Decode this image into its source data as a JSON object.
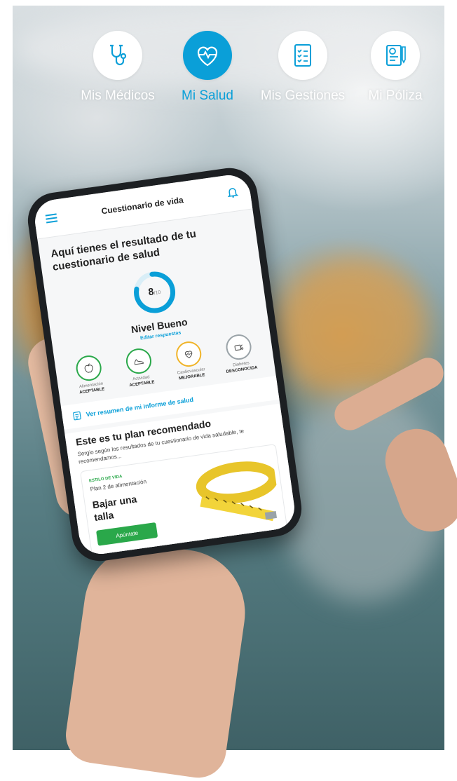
{
  "nav": {
    "items": [
      {
        "label": "Mis Médicos",
        "icon": "stethoscope-icon",
        "active": false
      },
      {
        "label": "Mi Salud",
        "icon": "heart-pulse-icon",
        "active": true
      },
      {
        "label": "Mis Gestiones",
        "icon": "checklist-icon",
        "active": false
      },
      {
        "label": "Mi Póliza",
        "icon": "policy-document-icon",
        "active": false
      }
    ]
  },
  "colors": {
    "accent": "#0a9fd8",
    "green": "#2aa84a",
    "warning": "#f0b429",
    "muted": "#9aa3a8"
  },
  "app": {
    "title": "Cuestionario de vida",
    "menu_icon": "hamburger-menu-icon",
    "bell_icon": "bell-icon",
    "result_title": "Aquí tienes el resultado de tu cuestionario de salud",
    "score": {
      "value": "8",
      "max": "/10",
      "progress": 0.8
    },
    "level": "Nivel Bueno",
    "edit_link": "Editar respuestas",
    "categories": [
      {
        "name": "Alimentación",
        "status": "ACEPTABLE",
        "icon": "apple-icon",
        "color": "#2aa84a"
      },
      {
        "name": "Actividad",
        "status": "ACEPTABLE",
        "icon": "sneaker-icon",
        "color": "#2aa84a"
      },
      {
        "name": "Cardiovascular",
        "status": "MEJORABLE",
        "icon": "heart-icon",
        "color": "#f0b429"
      },
      {
        "name": "Diabetes",
        "status": "DESCONOCIDA",
        "icon": "glucometer-icon",
        "color": "#9aa3a8"
      }
    ],
    "summary_link": "Ver resumen de mi informe de salud",
    "plan": {
      "title": "Este es tu plan recomendado",
      "description": "Sergio según los resultados de tu cuestionario de vida saludable, te recomendamos...",
      "card": {
        "tag": "ESTILO DE VIDA",
        "subtitle": "Plan 2 de alimentación",
        "headline": "Bajar una talla",
        "button": "Apúntate"
      }
    }
  }
}
